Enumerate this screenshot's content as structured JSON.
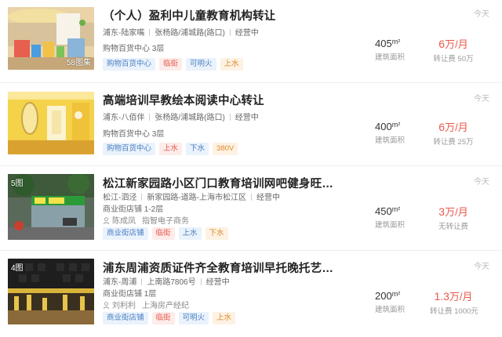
{
  "listings": [
    {
      "title": "（个人）盈利中儿童教育机构转让",
      "district": "浦东-陆家嘴",
      "address": "张杨路/浦城路(路口)",
      "status": "经营中",
      "floor": "购物百货中心 3层",
      "agent_name": "",
      "agent_company": "",
      "tags": [
        {
          "text": "购物百货中心",
          "color": "blue"
        },
        {
          "text": "临街",
          "color": "red"
        },
        {
          "text": "可明火",
          "color": "blue"
        },
        {
          "text": "上水",
          "color": "orange"
        }
      ],
      "photo_count": "58图集",
      "area_value": "405",
      "area_unit": "m²",
      "area_label": "建筑面积",
      "price_value": "6",
      "price_unit": "万/月",
      "price_label": "转让费 50万",
      "date": "今天"
    },
    {
      "title": "高端培训早教绘本阅读中心转让",
      "district": "浦东-八佰伴",
      "address": "张杨路/浦城路(路口)",
      "status": "经营中",
      "floor": "购物百货中心 3层",
      "agent_name": "",
      "agent_company": "",
      "tags": [
        {
          "text": "购物百货中心",
          "color": "blue"
        },
        {
          "text": "上水",
          "color": "red"
        },
        {
          "text": "下水",
          "color": "blue"
        },
        {
          "text": "380V",
          "color": "orange"
        }
      ],
      "photo_count": "",
      "area_value": "400",
      "area_unit": "m²",
      "area_label": "建筑面积",
      "price_value": "6",
      "price_unit": "万/月",
      "price_label": "转让费 25万",
      "date": "今天"
    },
    {
      "title": "松江新家园路小区门口教育培训网吧健身旺铺出租Y（...",
      "district": "松江-泗泾",
      "address": "新家园路-道路-上海市松江区",
      "status": "经营中",
      "floor": "商业街店铺 1-2层",
      "agent_name": "陈成凤",
      "agent_company": "指智电子商务",
      "tags": [
        {
          "text": "商业街店铺",
          "color": "blue"
        },
        {
          "text": "临街",
          "color": "red"
        },
        {
          "text": "上水",
          "color": "blue"
        },
        {
          "text": "下水",
          "color": "orange"
        }
      ],
      "photo_count": "5图",
      "area_value": "450",
      "area_unit": "m²",
      "area_label": "建筑面积",
      "price_value": "3",
      "price_unit": "万/月",
      "price_label": "无转让费",
      "date": "今天"
    },
    {
      "title": "浦东周浦资质证件齐全教育培训早托晚托艺术类文化类...",
      "district": "浦东-周浦",
      "address": "上南路7806号",
      "status": "经营中",
      "floor": "商业街店铺 1层",
      "agent_name": "刘利利",
      "agent_company": "上海房产经纪",
      "tags": [
        {
          "text": "商业街店铺",
          "color": "blue"
        },
        {
          "text": "临街",
          "color": "red"
        },
        {
          "text": "可明火",
          "color": "blue"
        },
        {
          "text": "上水",
          "color": "orange"
        }
      ],
      "photo_count": "4图",
      "area_value": "200",
      "area_unit": "m²",
      "area_label": "建筑面积",
      "price_value": "1.3",
      "price_unit": "万/月",
      "price_label": "转让费 1000元",
      "date": "今天"
    }
  ],
  "colors": {
    "price": "#e8584b",
    "tag_blue": "#4a7fc1",
    "tag_red": "#e8584b",
    "tag_orange": "#e08a2c"
  }
}
